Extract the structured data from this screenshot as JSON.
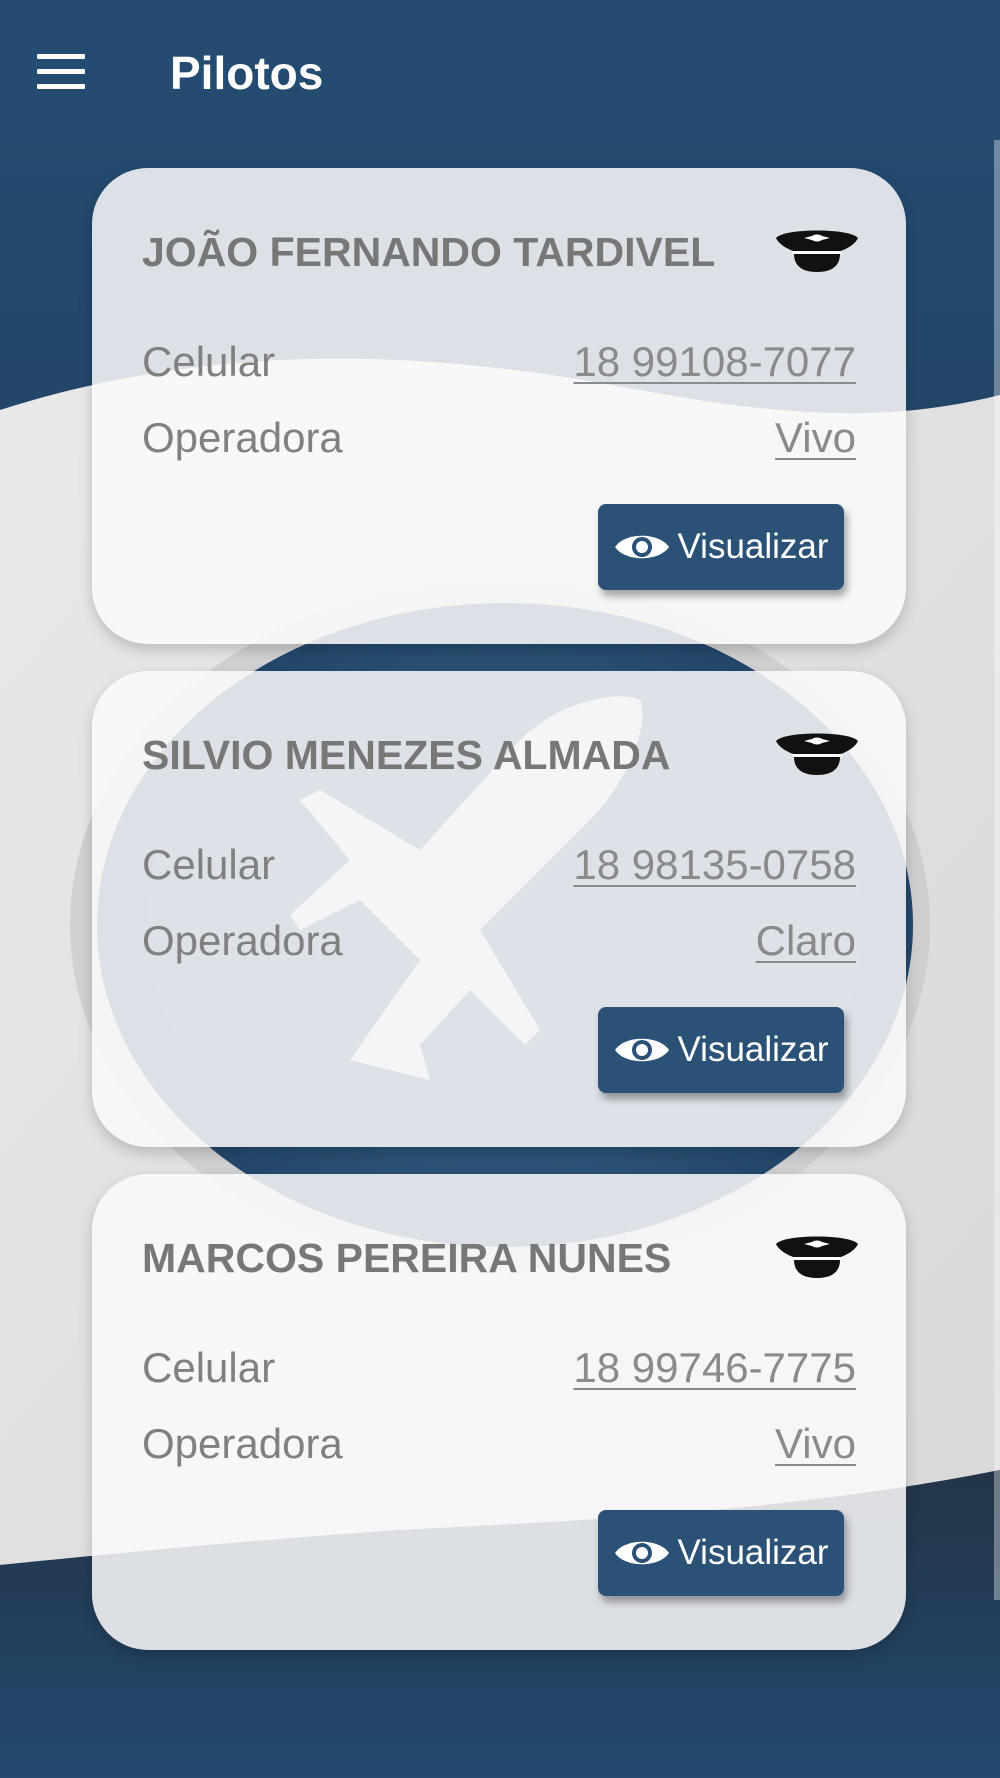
{
  "app_bar": {
    "title": "Pilotos",
    "menu_icon": "hamburger-menu-icon"
  },
  "colors": {
    "primary": "#244a6e",
    "button": "#2b5177",
    "card_background": "#f7f7f8",
    "text_muted": "#808080"
  },
  "pilots": [
    {
      "name": "JOÃO FERNANDO TARDIVEL",
      "icon": "pilot-cap-icon",
      "phone_label": "Celular",
      "phone": "18 99108-7077",
      "carrier_label": "Operadora",
      "carrier": "Vivo",
      "button_icon": "eye-icon",
      "button_label": "Visualizar"
    },
    {
      "name": "SILVIO MENEZES ALMADA",
      "icon": "pilot-cap-icon",
      "phone_label": "Celular",
      "phone": "18 98135-0758",
      "carrier_label": "Operadora",
      "carrier": "Claro",
      "button_icon": "eye-icon",
      "button_label": "Visualizar"
    },
    {
      "name": "MARCOS PEREIRA NUNES",
      "icon": "pilot-cap-icon",
      "phone_label": "Celular",
      "phone": "18 99746-7775",
      "carrier_label": "Operadora",
      "carrier": "Vivo",
      "button_icon": "eye-icon",
      "button_label": "Visualizar"
    }
  ]
}
